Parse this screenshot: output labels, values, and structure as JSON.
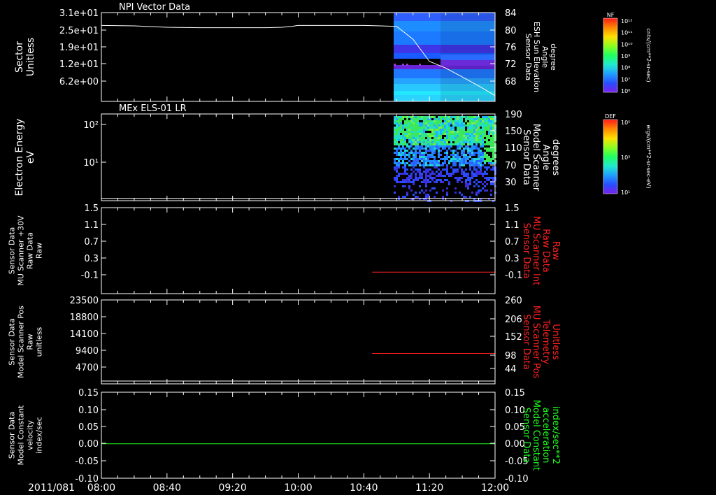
{
  "chart_data": [
    {
      "type": "heatmap",
      "title": "NPI Vector Data",
      "ylabel": [
        "Sector",
        "Unitless"
      ],
      "yticks": [
        "3.1e+01",
        "2.5e+01",
        "1.9e+01",
        "1.2e+01",
        "6.2e+00"
      ],
      "y2label": [
        "Sensor Data",
        "ESH Sun Elevation",
        "Angle",
        "degree"
      ],
      "y2ticks": [
        "84",
        "80",
        "76",
        "72",
        "68"
      ],
      "y2lim": [
        64,
        84
      ],
      "overlay_line": {
        "name": "ESH Sun Elevation Angle",
        "x": [
          0,
          20,
          40,
          60,
          80,
          100,
          110,
          116,
          118,
          120,
          122,
          126,
          130,
          140,
          150,
          160,
          170,
          180,
          190,
          200,
          210,
          220,
          230,
          240
        ],
        "y": [
          81.1,
          81.0,
          80.7,
          80.6,
          80.6,
          80.6,
          80.7,
          80.9,
          81.0,
          81.1,
          81.1,
          81.1,
          81.1,
          81.1,
          81.1,
          81.1,
          81.0,
          80.9,
          78,
          73,
          71.5,
          69.5,
          67.5,
          65.3
        ]
      },
      "colorbar": {
        "label": "NF",
        "units": "cnts/(cm**2-sr-sec)",
        "ticks": [
          "10¹²",
          "10¹¹",
          "10¹⁰",
          "10⁹",
          "10⁸",
          "10⁷",
          "10⁶"
        ]
      }
    },
    {
      "type": "heatmap",
      "title": "MEx ELS-01 LR",
      "ylabel": [
        "Electron Energy",
        "eV"
      ],
      "yticks": [
        "10²",
        "10¹"
      ],
      "y2label": [
        "Sensor Data",
        "Model Scanner",
        "Angle",
        "degrees"
      ],
      "y2ticks": [
        "190",
        "150",
        "110",
        "70",
        "30"
      ],
      "y2lim": [
        0,
        190
      ],
      "overlay_line": {
        "name": "Model Scanner Angle",
        "x": [
          0,
          240
        ],
        "y": [
          5,
          5
        ]
      },
      "colorbar": {
        "label": "DEF",
        "units": "ergs/(cm**2-sr-sec-eV)",
        "ticks": [
          "10⁵",
          "10³",
          "10¹"
        ]
      }
    },
    {
      "type": "line",
      "ylabel": [
        "Sensor Data",
        "MU Scanner +30V",
        "Raw Data",
        "Raw"
      ],
      "yticks": [
        "1.5",
        "1.1",
        "0.7",
        "0.3",
        "-0.1"
      ],
      "ylim": [
        -0.5,
        1.5
      ],
      "y2label": [
        "Sensor Data",
        "MU Scanner Int",
        "Raw Data",
        "Raw"
      ],
      "y2ticks": [
        "1.5",
        "1.1",
        "0.7",
        "0.3",
        "-0.1"
      ],
      "series": [
        {
          "name": "MU Scanner Int Raw Data",
          "color": "#ff2020",
          "x": [
            165,
            240
          ],
          "y": [
            0.0,
            0.0
          ]
        }
      ]
    },
    {
      "type": "line",
      "ylabel": [
        "Sensor Data",
        "Model Scanner Pos",
        "Raw",
        "unitless"
      ],
      "yticks": [
        "23500",
        "18800",
        "14100",
        "9400",
        "4700"
      ],
      "y2label": [
        "Sensor Data",
        "MU Scanner Pos",
        "Telemetry",
        "Unitless"
      ],
      "y2ticks": [
        "260",
        "206",
        "152",
        "98",
        "44"
      ],
      "y2lim": [
        -10,
        260
      ],
      "series": [
        {
          "name": "MU Scanner Pos Telemetry",
          "color": "#ff2020",
          "x": [
            165,
            240
          ],
          "y": [
            88,
            88
          ]
        }
      ]
    },
    {
      "type": "line",
      "ylabel": [
        "Sensor Data",
        "Model Constant",
        "velocity",
        "index/sec"
      ],
      "yticks": [
        "0.15",
        "0.10",
        "0.05",
        "0.00",
        "-0.05",
        "-0.10"
      ],
      "ylim": [
        -0.1,
        0.15
      ],
      "y2label": [
        "Sensor Data",
        "Model Constant",
        "acceleration",
        "index/sec**2"
      ],
      "y2ticks": [
        "0.15",
        "0.10",
        "0.05",
        "0.00",
        "-0.05",
        "-0.10"
      ],
      "series": [
        {
          "name": "Model Constant acceleration",
          "color": "#20ff20",
          "x": [
            0,
            240
          ],
          "y": [
            0.0,
            0.0
          ]
        }
      ]
    }
  ],
  "xaxis": {
    "date": "2011/081",
    "ticks": [
      "08:00",
      "08:40",
      "09:20",
      "10:00",
      "10:40",
      "11:20",
      "12:00"
    ],
    "range_minutes": [
      0,
      240
    ]
  }
}
